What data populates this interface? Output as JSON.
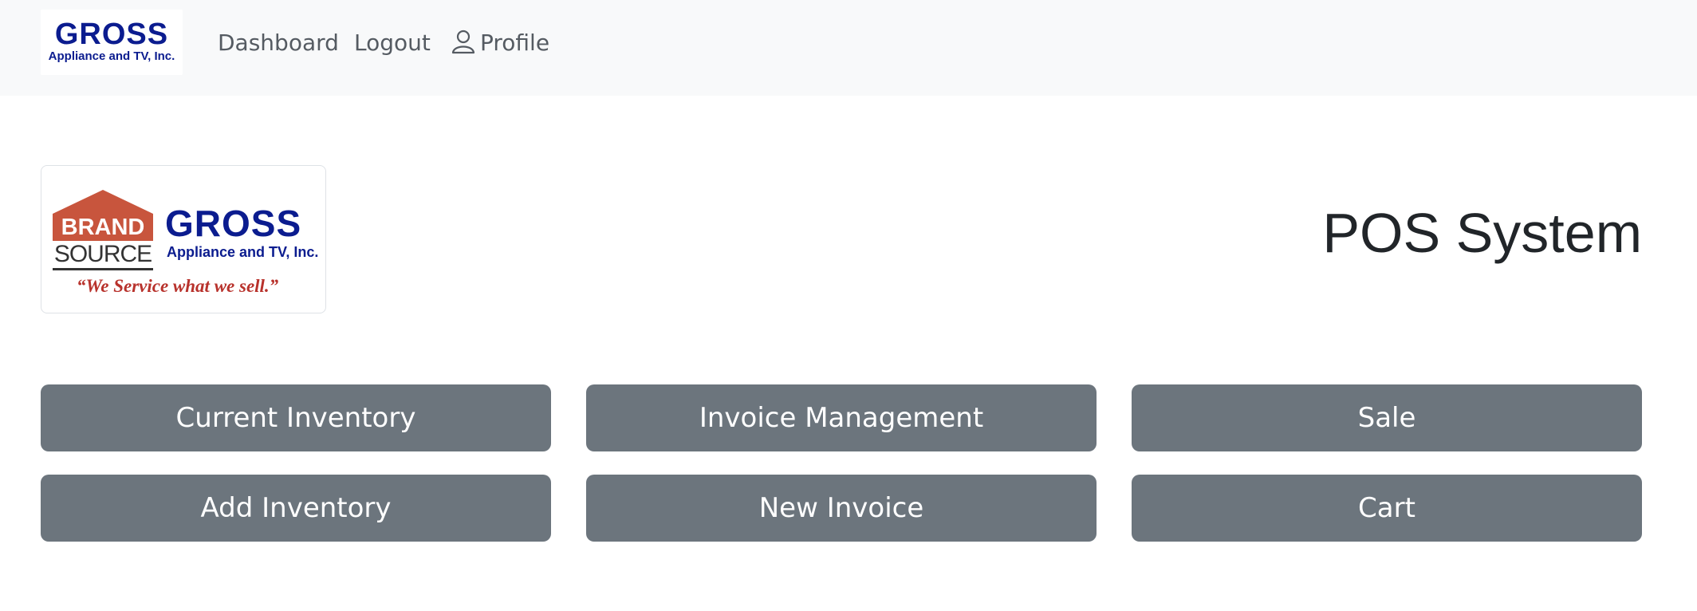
{
  "navbar": {
    "logo": {
      "text_big": "GROSS",
      "text_small": "Appliance and TV, Inc."
    },
    "links": {
      "dashboard": "Dashboard",
      "logout": "Logout",
      "profile": "Profile"
    },
    "profile_icon": "person-icon"
  },
  "brand_logo": {
    "brand": "BRAND",
    "source": "SOURCE",
    "gross": "GROSS",
    "company": "Appliance and TV, Inc.",
    "slogan": "“We Service what we sell.”"
  },
  "page": {
    "title": "POS System"
  },
  "buttons": {
    "current_inventory": "Current Inventory",
    "invoice_management": "Invoice Management",
    "sale": "Sale",
    "add_inventory": "Add Inventory",
    "new_invoice": "New Invoice",
    "cart": "Cart"
  },
  "colors": {
    "navbar_bg": "#f8f9fa",
    "button_bg": "#6c757d",
    "brand_blue": "#0b1c8f",
    "brand_red": "#c8553d"
  }
}
